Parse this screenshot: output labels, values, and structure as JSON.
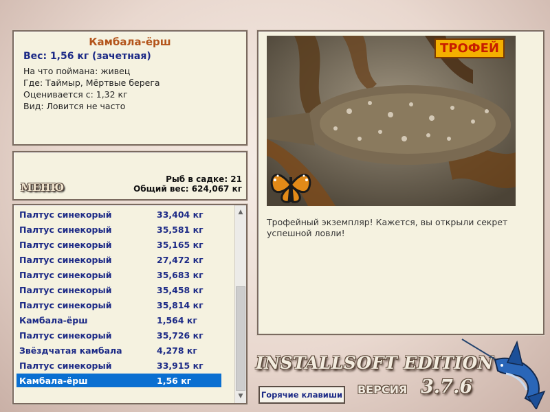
{
  "fish_info": {
    "name": "Камбала-ёрш",
    "weight": "Вес: 1,56 кг (зачетная)",
    "bait": "На что поймана: живец",
    "place": "Где: Таймыр, Мёртвые берега",
    "price": "Оценивается с: 1,32 кг",
    "kind": "Вид: Ловится не часто"
  },
  "stats": {
    "menu_label": "МЕНЮ",
    "fish_count": "Рыб в садке: 21",
    "total_weight": "Общий вес: 624,067 кг"
  },
  "catch_list": [
    {
      "name": "Палтус синекорый",
      "weight": "33,404 кг"
    },
    {
      "name": "Палтус синекорый",
      "weight": "35,581 кг"
    },
    {
      "name": "Палтус синекорый",
      "weight": "35,165 кг"
    },
    {
      "name": "Палтус синекорый",
      "weight": "27,472 кг"
    },
    {
      "name": "Палтус синекорый",
      "weight": "35,683 кг"
    },
    {
      "name": "Палтус синекорый",
      "weight": "35,458 кг"
    },
    {
      "name": "Палтус синекорый",
      "weight": "35,814 кг"
    },
    {
      "name": "Камбала-ёрш",
      "weight": "1,564 кг"
    },
    {
      "name": "Палтус синекорый",
      "weight": "35,726 кг"
    },
    {
      "name": "Звёздчатая камбала",
      "weight": "4,278 кг"
    },
    {
      "name": "Палтус синекорый",
      "weight": "33,915 кг"
    },
    {
      "name": "Камбала-ёрш",
      "weight": "1,56 кг"
    }
  ],
  "photo": {
    "trophy_label": "ТРОФЕЙ",
    "message": "Трофейный экземпляр! Кажется, вы открыли секрет успешной ловли!"
  },
  "footer": {
    "brand": "INSTALLSOFT EDITION",
    "version_label": "ВЕРСИЯ",
    "version_number": "3.7.6",
    "hotkeys_label": "Горячие клавиши"
  }
}
